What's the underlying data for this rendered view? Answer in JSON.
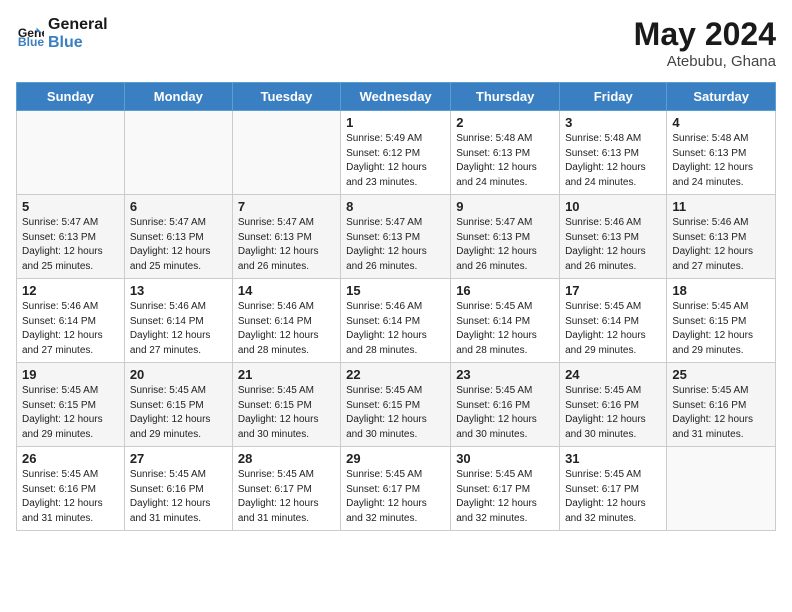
{
  "header": {
    "logo_line1": "General",
    "logo_line2": "Blue",
    "month_year": "May 2024",
    "location": "Atebubu, Ghana"
  },
  "days_of_week": [
    "Sunday",
    "Monday",
    "Tuesday",
    "Wednesday",
    "Thursday",
    "Friday",
    "Saturday"
  ],
  "weeks": [
    [
      {
        "day": "",
        "sunrise": "",
        "sunset": "",
        "daylight": ""
      },
      {
        "day": "",
        "sunrise": "",
        "sunset": "",
        "daylight": ""
      },
      {
        "day": "",
        "sunrise": "",
        "sunset": "",
        "daylight": ""
      },
      {
        "day": "1",
        "sunrise": "Sunrise: 5:49 AM",
        "sunset": "Sunset: 6:12 PM",
        "daylight": "Daylight: 12 hours and 23 minutes."
      },
      {
        "day": "2",
        "sunrise": "Sunrise: 5:48 AM",
        "sunset": "Sunset: 6:13 PM",
        "daylight": "Daylight: 12 hours and 24 minutes."
      },
      {
        "day": "3",
        "sunrise": "Sunrise: 5:48 AM",
        "sunset": "Sunset: 6:13 PM",
        "daylight": "Daylight: 12 hours and 24 minutes."
      },
      {
        "day": "4",
        "sunrise": "Sunrise: 5:48 AM",
        "sunset": "Sunset: 6:13 PM",
        "daylight": "Daylight: 12 hours and 24 minutes."
      }
    ],
    [
      {
        "day": "5",
        "sunrise": "Sunrise: 5:47 AM",
        "sunset": "Sunset: 6:13 PM",
        "daylight": "Daylight: 12 hours and 25 minutes."
      },
      {
        "day": "6",
        "sunrise": "Sunrise: 5:47 AM",
        "sunset": "Sunset: 6:13 PM",
        "daylight": "Daylight: 12 hours and 25 minutes."
      },
      {
        "day": "7",
        "sunrise": "Sunrise: 5:47 AM",
        "sunset": "Sunset: 6:13 PM",
        "daylight": "Daylight: 12 hours and 26 minutes."
      },
      {
        "day": "8",
        "sunrise": "Sunrise: 5:47 AM",
        "sunset": "Sunset: 6:13 PM",
        "daylight": "Daylight: 12 hours and 26 minutes."
      },
      {
        "day": "9",
        "sunrise": "Sunrise: 5:47 AM",
        "sunset": "Sunset: 6:13 PM",
        "daylight": "Daylight: 12 hours and 26 minutes."
      },
      {
        "day": "10",
        "sunrise": "Sunrise: 5:46 AM",
        "sunset": "Sunset: 6:13 PM",
        "daylight": "Daylight: 12 hours and 26 minutes."
      },
      {
        "day": "11",
        "sunrise": "Sunrise: 5:46 AM",
        "sunset": "Sunset: 6:13 PM",
        "daylight": "Daylight: 12 hours and 27 minutes."
      }
    ],
    [
      {
        "day": "12",
        "sunrise": "Sunrise: 5:46 AM",
        "sunset": "Sunset: 6:14 PM",
        "daylight": "Daylight: 12 hours and 27 minutes."
      },
      {
        "day": "13",
        "sunrise": "Sunrise: 5:46 AM",
        "sunset": "Sunset: 6:14 PM",
        "daylight": "Daylight: 12 hours and 27 minutes."
      },
      {
        "day": "14",
        "sunrise": "Sunrise: 5:46 AM",
        "sunset": "Sunset: 6:14 PM",
        "daylight": "Daylight: 12 hours and 28 minutes."
      },
      {
        "day": "15",
        "sunrise": "Sunrise: 5:46 AM",
        "sunset": "Sunset: 6:14 PM",
        "daylight": "Daylight: 12 hours and 28 minutes."
      },
      {
        "day": "16",
        "sunrise": "Sunrise: 5:45 AM",
        "sunset": "Sunset: 6:14 PM",
        "daylight": "Daylight: 12 hours and 28 minutes."
      },
      {
        "day": "17",
        "sunrise": "Sunrise: 5:45 AM",
        "sunset": "Sunset: 6:14 PM",
        "daylight": "Daylight: 12 hours and 29 minutes."
      },
      {
        "day": "18",
        "sunrise": "Sunrise: 5:45 AM",
        "sunset": "Sunset: 6:15 PM",
        "daylight": "Daylight: 12 hours and 29 minutes."
      }
    ],
    [
      {
        "day": "19",
        "sunrise": "Sunrise: 5:45 AM",
        "sunset": "Sunset: 6:15 PM",
        "daylight": "Daylight: 12 hours and 29 minutes."
      },
      {
        "day": "20",
        "sunrise": "Sunrise: 5:45 AM",
        "sunset": "Sunset: 6:15 PM",
        "daylight": "Daylight: 12 hours and 29 minutes."
      },
      {
        "day": "21",
        "sunrise": "Sunrise: 5:45 AM",
        "sunset": "Sunset: 6:15 PM",
        "daylight": "Daylight: 12 hours and 30 minutes."
      },
      {
        "day": "22",
        "sunrise": "Sunrise: 5:45 AM",
        "sunset": "Sunset: 6:15 PM",
        "daylight": "Daylight: 12 hours and 30 minutes."
      },
      {
        "day": "23",
        "sunrise": "Sunrise: 5:45 AM",
        "sunset": "Sunset: 6:16 PM",
        "daylight": "Daylight: 12 hours and 30 minutes."
      },
      {
        "day": "24",
        "sunrise": "Sunrise: 5:45 AM",
        "sunset": "Sunset: 6:16 PM",
        "daylight": "Daylight: 12 hours and 30 minutes."
      },
      {
        "day": "25",
        "sunrise": "Sunrise: 5:45 AM",
        "sunset": "Sunset: 6:16 PM",
        "daylight": "Daylight: 12 hours and 31 minutes."
      }
    ],
    [
      {
        "day": "26",
        "sunrise": "Sunrise: 5:45 AM",
        "sunset": "Sunset: 6:16 PM",
        "daylight": "Daylight: 12 hours and 31 minutes."
      },
      {
        "day": "27",
        "sunrise": "Sunrise: 5:45 AM",
        "sunset": "Sunset: 6:16 PM",
        "daylight": "Daylight: 12 hours and 31 minutes."
      },
      {
        "day": "28",
        "sunrise": "Sunrise: 5:45 AM",
        "sunset": "Sunset: 6:17 PM",
        "daylight": "Daylight: 12 hours and 31 minutes."
      },
      {
        "day": "29",
        "sunrise": "Sunrise: 5:45 AM",
        "sunset": "Sunset: 6:17 PM",
        "daylight": "Daylight: 12 hours and 32 minutes."
      },
      {
        "day": "30",
        "sunrise": "Sunrise: 5:45 AM",
        "sunset": "Sunset: 6:17 PM",
        "daylight": "Daylight: 12 hours and 32 minutes."
      },
      {
        "day": "31",
        "sunrise": "Sunrise: 5:45 AM",
        "sunset": "Sunset: 6:17 PM",
        "daylight": "Daylight: 12 hours and 32 minutes."
      },
      {
        "day": "",
        "sunrise": "",
        "sunset": "",
        "daylight": ""
      }
    ]
  ]
}
